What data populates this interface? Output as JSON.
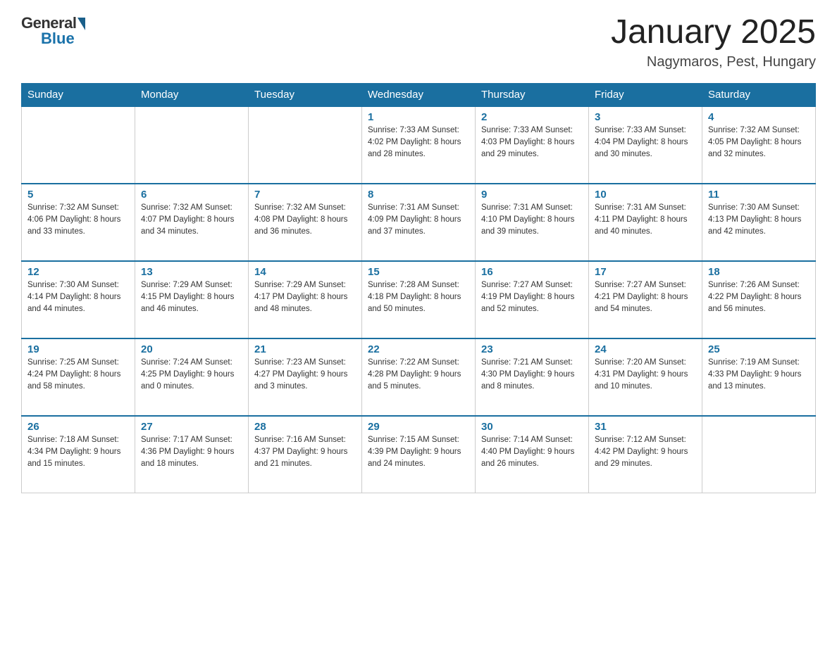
{
  "header": {
    "title": "January 2025",
    "location": "Nagymaros, Pest, Hungary",
    "logo": {
      "general": "General",
      "blue": "Blue"
    }
  },
  "days_of_week": [
    "Sunday",
    "Monday",
    "Tuesday",
    "Wednesday",
    "Thursday",
    "Friday",
    "Saturday"
  ],
  "weeks": [
    [
      {
        "day": "",
        "info": ""
      },
      {
        "day": "",
        "info": ""
      },
      {
        "day": "",
        "info": ""
      },
      {
        "day": "1",
        "info": "Sunrise: 7:33 AM\nSunset: 4:02 PM\nDaylight: 8 hours\nand 28 minutes."
      },
      {
        "day": "2",
        "info": "Sunrise: 7:33 AM\nSunset: 4:03 PM\nDaylight: 8 hours\nand 29 minutes."
      },
      {
        "day": "3",
        "info": "Sunrise: 7:33 AM\nSunset: 4:04 PM\nDaylight: 8 hours\nand 30 minutes."
      },
      {
        "day": "4",
        "info": "Sunrise: 7:32 AM\nSunset: 4:05 PM\nDaylight: 8 hours\nand 32 minutes."
      }
    ],
    [
      {
        "day": "5",
        "info": "Sunrise: 7:32 AM\nSunset: 4:06 PM\nDaylight: 8 hours\nand 33 minutes."
      },
      {
        "day": "6",
        "info": "Sunrise: 7:32 AM\nSunset: 4:07 PM\nDaylight: 8 hours\nand 34 minutes."
      },
      {
        "day": "7",
        "info": "Sunrise: 7:32 AM\nSunset: 4:08 PM\nDaylight: 8 hours\nand 36 minutes."
      },
      {
        "day": "8",
        "info": "Sunrise: 7:31 AM\nSunset: 4:09 PM\nDaylight: 8 hours\nand 37 minutes."
      },
      {
        "day": "9",
        "info": "Sunrise: 7:31 AM\nSunset: 4:10 PM\nDaylight: 8 hours\nand 39 minutes."
      },
      {
        "day": "10",
        "info": "Sunrise: 7:31 AM\nSunset: 4:11 PM\nDaylight: 8 hours\nand 40 minutes."
      },
      {
        "day": "11",
        "info": "Sunrise: 7:30 AM\nSunset: 4:13 PM\nDaylight: 8 hours\nand 42 minutes."
      }
    ],
    [
      {
        "day": "12",
        "info": "Sunrise: 7:30 AM\nSunset: 4:14 PM\nDaylight: 8 hours\nand 44 minutes."
      },
      {
        "day": "13",
        "info": "Sunrise: 7:29 AM\nSunset: 4:15 PM\nDaylight: 8 hours\nand 46 minutes."
      },
      {
        "day": "14",
        "info": "Sunrise: 7:29 AM\nSunset: 4:17 PM\nDaylight: 8 hours\nand 48 minutes."
      },
      {
        "day": "15",
        "info": "Sunrise: 7:28 AM\nSunset: 4:18 PM\nDaylight: 8 hours\nand 50 minutes."
      },
      {
        "day": "16",
        "info": "Sunrise: 7:27 AM\nSunset: 4:19 PM\nDaylight: 8 hours\nand 52 minutes."
      },
      {
        "day": "17",
        "info": "Sunrise: 7:27 AM\nSunset: 4:21 PM\nDaylight: 8 hours\nand 54 minutes."
      },
      {
        "day": "18",
        "info": "Sunrise: 7:26 AM\nSunset: 4:22 PM\nDaylight: 8 hours\nand 56 minutes."
      }
    ],
    [
      {
        "day": "19",
        "info": "Sunrise: 7:25 AM\nSunset: 4:24 PM\nDaylight: 8 hours\nand 58 minutes."
      },
      {
        "day": "20",
        "info": "Sunrise: 7:24 AM\nSunset: 4:25 PM\nDaylight: 9 hours\nand 0 minutes."
      },
      {
        "day": "21",
        "info": "Sunrise: 7:23 AM\nSunset: 4:27 PM\nDaylight: 9 hours\nand 3 minutes."
      },
      {
        "day": "22",
        "info": "Sunrise: 7:22 AM\nSunset: 4:28 PM\nDaylight: 9 hours\nand 5 minutes."
      },
      {
        "day": "23",
        "info": "Sunrise: 7:21 AM\nSunset: 4:30 PM\nDaylight: 9 hours\nand 8 minutes."
      },
      {
        "day": "24",
        "info": "Sunrise: 7:20 AM\nSunset: 4:31 PM\nDaylight: 9 hours\nand 10 minutes."
      },
      {
        "day": "25",
        "info": "Sunrise: 7:19 AM\nSunset: 4:33 PM\nDaylight: 9 hours\nand 13 minutes."
      }
    ],
    [
      {
        "day": "26",
        "info": "Sunrise: 7:18 AM\nSunset: 4:34 PM\nDaylight: 9 hours\nand 15 minutes."
      },
      {
        "day": "27",
        "info": "Sunrise: 7:17 AM\nSunset: 4:36 PM\nDaylight: 9 hours\nand 18 minutes."
      },
      {
        "day": "28",
        "info": "Sunrise: 7:16 AM\nSunset: 4:37 PM\nDaylight: 9 hours\nand 21 minutes."
      },
      {
        "day": "29",
        "info": "Sunrise: 7:15 AM\nSunset: 4:39 PM\nDaylight: 9 hours\nand 24 minutes."
      },
      {
        "day": "30",
        "info": "Sunrise: 7:14 AM\nSunset: 4:40 PM\nDaylight: 9 hours\nand 26 minutes."
      },
      {
        "day": "31",
        "info": "Sunrise: 7:12 AM\nSunset: 4:42 PM\nDaylight: 9 hours\nand 29 minutes."
      },
      {
        "day": "",
        "info": ""
      }
    ]
  ]
}
